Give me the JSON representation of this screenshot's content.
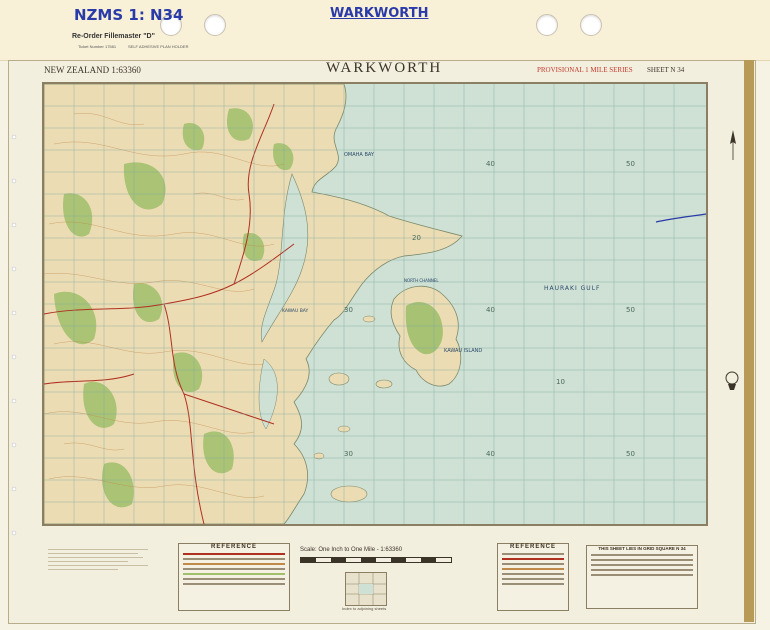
{
  "header": {
    "code": "NZMS 1: N34",
    "name_handwritten": "WARKWORTH",
    "reorder": "Re-Order Fillemaster \"D\"",
    "ticket_no": "Ticket Number 17581",
    "self_adhesive": "SELF ADHESIVE PLAN HOLDER"
  },
  "map": {
    "title": "WARKWORTH",
    "scale_ratio": "NEW ZEALAND 1:63360",
    "series": "PROVISIONAL 1 MILE SERIES",
    "sheet": "SHEET N 34",
    "scale_text": "Scale: One Inch to One Mile - 1:63360",
    "reference_left": "REFERENCE",
    "reference_right": "REFERENCE",
    "grid_ref_box": "THIS SHEET LIES IN GRID SQUARE N 34",
    "index_caption": "Index to adjoining sheets",
    "place_labels": {
      "omaha_bay": "OMAHA BAY",
      "hauraki_gulf": "HAURAKI  GULF",
      "kawau_island": "KAWAU ISLAND",
      "kawau_bay": "KAWAU BAY",
      "north_channel": "NORTH CHANNEL"
    },
    "grid_numbers": {
      "g40a": "40",
      "g50a": "50",
      "g20": "20",
      "g30": "30",
      "g40b": "40",
      "g50b": "50",
      "g10": "10",
      "g30b": "30",
      "g40c": "40",
      "g50c": "50"
    }
  },
  "colors": {
    "sea": "#cfe0d4",
    "land": "#ecdcb4",
    "forest": "#9fbf6a",
    "grid": "#7fa8a0",
    "contour": "#c08a4a",
    "road": "#b03020",
    "handwriting": "#2a3aa8",
    "series_red": "#c0392b"
  }
}
